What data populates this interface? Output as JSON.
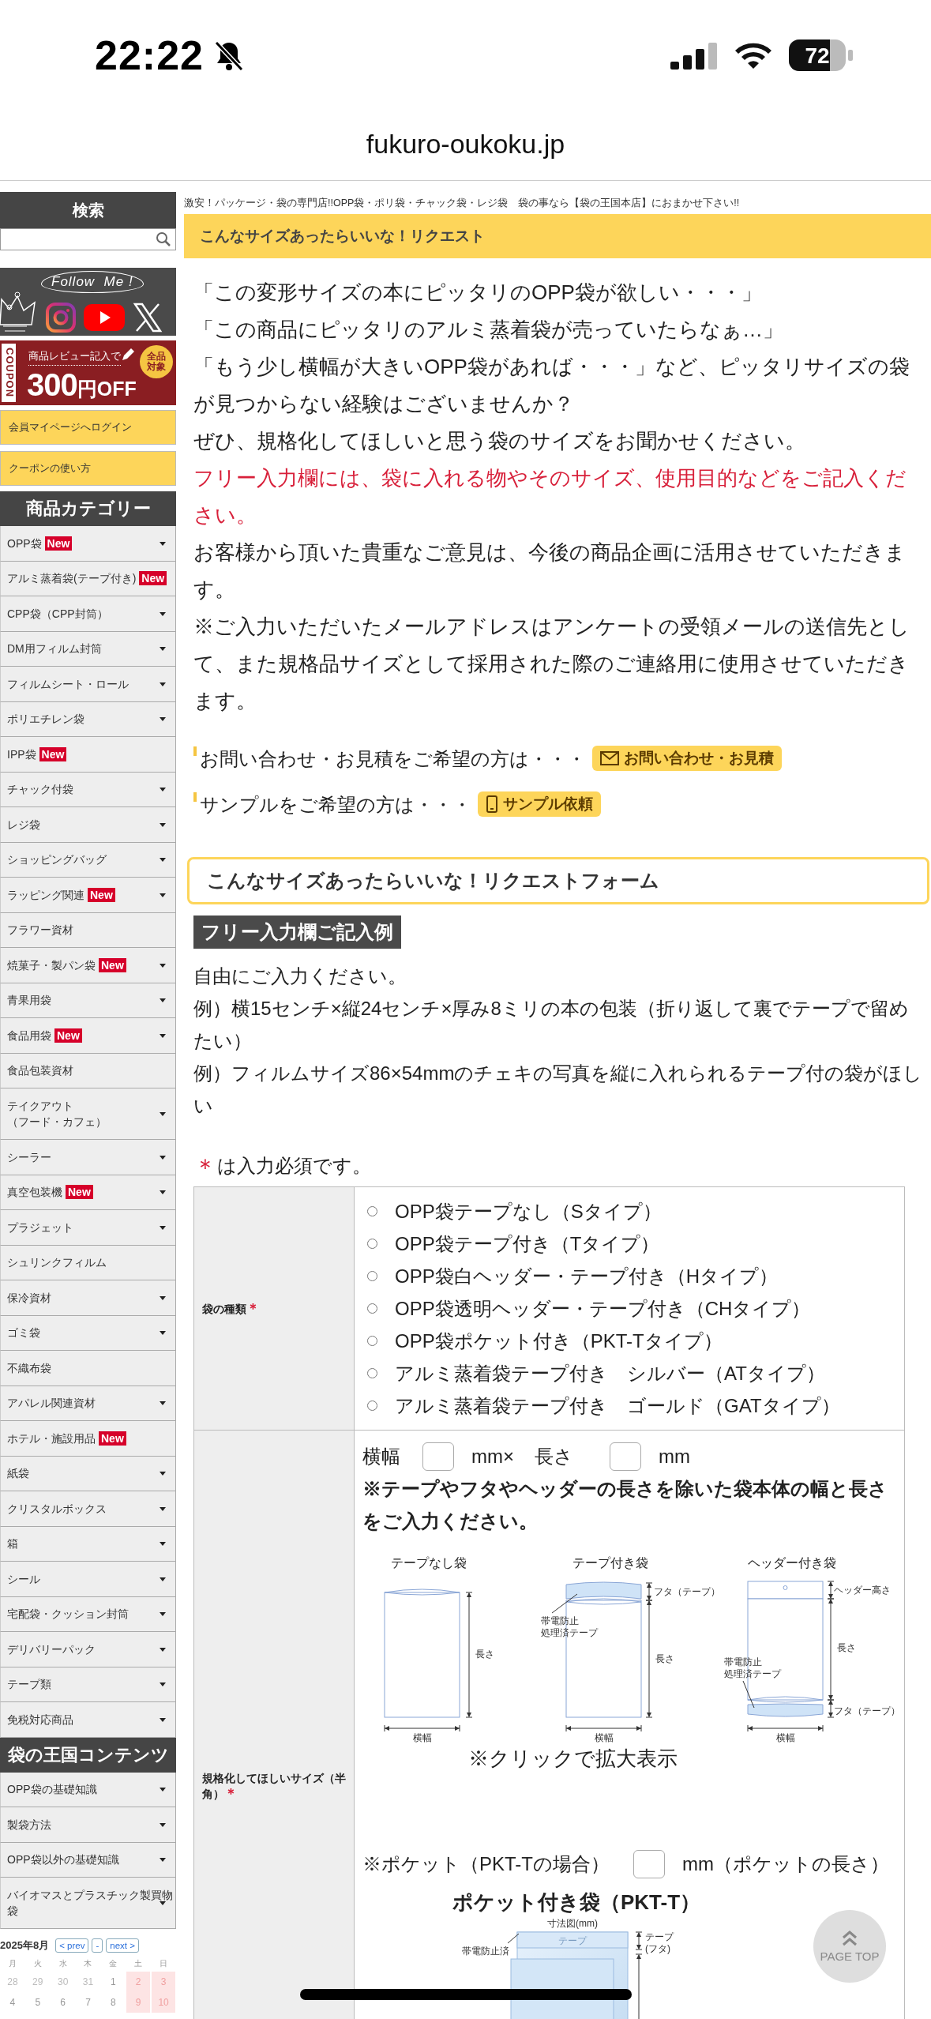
{
  "status_bar": {
    "time": "22:22",
    "battery": "72"
  },
  "browser": {
    "url": "fukuro-oukoku.jp"
  },
  "sidebar": {
    "search_title": "検索",
    "follow_banner": {
      "text": "Follow  Me !"
    },
    "coupon_banner": {
      "tab": "COUPON",
      "caption": "商品レビュー記入で",
      "amount": "300",
      "unit": "円OFF",
      "badge": "全品対象"
    },
    "links": [
      "会員マイページへログイン",
      "クーポンの使い方"
    ],
    "categories_title": "商品カテゴリー",
    "categories": [
      {
        "label": "OPP袋",
        "badge": "New",
        "expandable": true
      },
      {
        "label": "アルミ蒸着袋(テープ付き)",
        "badge": "New",
        "expandable": false
      },
      {
        "label": "CPP袋（CPP封筒）",
        "expandable": true
      },
      {
        "label": "DM用フィルム封筒",
        "expandable": true
      },
      {
        "label": "フィルムシート・ロール",
        "expandable": true
      },
      {
        "label": "ポリエチレン袋",
        "expandable": true
      },
      {
        "label": "IPP袋",
        "badge": "New",
        "expandable": false
      },
      {
        "label": "チャック付袋",
        "expandable": true
      },
      {
        "label": "レジ袋",
        "expandable": true
      },
      {
        "label": "ショッピングバッグ",
        "expandable": true
      },
      {
        "label": "ラッピング関連",
        "badge": "New",
        "expandable": true
      },
      {
        "label": "フラワー資材",
        "expandable": false
      },
      {
        "label": "焼菓子・製パン袋",
        "badge": "New",
        "expandable": true
      },
      {
        "label": "青果用袋",
        "expandable": true
      },
      {
        "label": "食品用袋",
        "badge": "New",
        "expandable": true
      },
      {
        "label": "食品包装資材",
        "expandable": false
      },
      {
        "label": "テイクアウト",
        "sublabel": "（フード・カフェ）",
        "expandable": true
      },
      {
        "label": "シーラー",
        "expandable": true
      },
      {
        "label": "真空包装機",
        "badge": "New",
        "expandable": true
      },
      {
        "label": "プラジェット",
        "expandable": true
      },
      {
        "label": "シュリンクフィルム",
        "expandable": false
      },
      {
        "label": "保冷資材",
        "expandable": true
      },
      {
        "label": "ゴミ袋",
        "expandable": true
      },
      {
        "label": "不織布袋",
        "expandable": false
      },
      {
        "label": "アパレル関連資材",
        "expandable": true
      },
      {
        "label": "ホテル・施設用品",
        "badge": "New",
        "expandable": false
      },
      {
        "label": "紙袋",
        "expandable": true
      },
      {
        "label": "クリスタルボックス",
        "expandable": true
      },
      {
        "label": "箱",
        "expandable": true
      },
      {
        "label": "シール",
        "expandable": true
      },
      {
        "label": "宅配袋・クッション封筒",
        "expandable": true
      },
      {
        "label": "デリバリーパック",
        "expandable": true
      },
      {
        "label": "テープ類",
        "expandable": true
      },
      {
        "label": "免税対応商品",
        "expandable": true
      }
    ],
    "contents_title": "袋の王国コンテンツ",
    "contents": [
      {
        "label": "OPP袋の基礎知識",
        "expandable": true
      },
      {
        "label": "製袋方法",
        "expandable": true
      },
      {
        "label": "OPP袋以外の基礎知識",
        "expandable": true
      },
      {
        "label": "バイオマスとプラスチック製買物袋",
        "expandable": true
      }
    ],
    "calendar": {
      "title": "2025年8月",
      "buttons": [
        "< prev",
        "-",
        "next >"
      ],
      "weekdays": [
        "月",
        "火",
        "水",
        "木",
        "金",
        "土",
        "日"
      ],
      "weeks": [
        [
          {
            "day": "28",
            "kind": "other"
          },
          {
            "day": "29",
            "kind": "other"
          },
          {
            "day": "30",
            "kind": "other"
          },
          {
            "day": "31",
            "kind": "other"
          },
          {
            "day": "1",
            "kind": "normal"
          },
          {
            "day": "2",
            "kind": "holiday"
          },
          {
            "day": "3",
            "kind": "holiday"
          }
        ],
        [
          {
            "day": "4",
            "kind": "normal"
          },
          {
            "day": "5",
            "kind": "normal"
          },
          {
            "day": "6",
            "kind": "normal"
          },
          {
            "day": "7",
            "kind": "normal"
          },
          {
            "day": "8",
            "kind": "normal"
          },
          {
            "day": "9",
            "kind": "holiday"
          },
          {
            "day": "10",
            "kind": "holiday"
          }
        ]
      ]
    }
  },
  "main": {
    "tagline": "激安！パッケージ・袋の専門店!!OPP袋・ポリ袋・チャック袋・レジ袋　袋の事なら【袋の王国本店】におまかせ下さい!!",
    "title": "こんなサイズあったらいいな！リクエスト",
    "quotes": [
      "「この変形サイズの本にピッタリのOPP袋が欲しい・・・」",
      "「この商品にピッタリのアルミ蒸着袋が売っていたらなぁ…」",
      "「もう少し横幅が大きいOPP袋があれば・・・」など、ピッタリサイズの袋が見つからない経験はございませんか？"
    ],
    "paragraphs": [
      {
        "kind": "normal",
        "text": "ぜひ、規格化してほしいと思う袋のサイズをお聞かせください。"
      },
      {
        "kind": "notice",
        "text": "フリー入力欄には、袋に入れる物やそのサイズ、使用目的などをご記入ください。"
      },
      {
        "kind": "normal",
        "text": "お客様から頂いた貴重なご意見は、今後の商品企画に活用させていただきます。"
      },
      {
        "kind": "normal",
        "text": "※ご入力いただいたメールアドレスはアンケートの受領メールの送信先として、また規格品サイズとして採用された際のご連絡用に使用させていただきます。"
      }
    ],
    "contacts": [
      {
        "text": "お問い合わせ・お見積をご希望の方は・・・",
        "button": "お問い合わせ・お見積",
        "kind": "mail"
      },
      {
        "text": "サンプルをご希望の方は・・・",
        "button": "サンプル依頼",
        "kind": "sample"
      }
    ],
    "form_title": "こんなサイズあったらいいな！リクエストフォーム",
    "example_title": "フリー入力欄ご記入例",
    "example_lines": [
      "自由にご入力ください。",
      "例）横15センチ×縦24センチ×厚み8ミリの本の包装（折り返して裏でテープで留めたい）",
      "例）フィルムサイズ86×54mmのチェキの写真を縦に入れられるテープ付の袋がほしい"
    ],
    "required_note": {
      "mark": "＊",
      "text": "は入力必須です。"
    },
    "form": {
      "bag_type": {
        "label": "袋の種類",
        "mark": "＊",
        "options": [
          {
            "label": "OPP袋テープなし（Sタイプ）",
            "selected": false
          },
          {
            "label": "OPP袋テープ付き（Tタイプ）",
            "selected": false
          },
          {
            "label": "OPP袋白ヘッダー・テープ付き（Hタイプ）",
            "selected": false
          },
          {
            "label": "OPP袋透明ヘッダー・テープ付き（CHタイプ）",
            "selected": false
          },
          {
            "label": "OPP袋ポケット付き（PKT-Tタイプ）",
            "selected": false
          },
          {
            "label": "アルミ蒸着袋テープ付き　シルバー（ATタイプ）",
            "selected": false
          },
          {
            "label": "アルミ蒸着袋テープ付き　ゴールド（GATタイプ）",
            "selected": false
          }
        ]
      },
      "size": {
        "label": "規格化してほしいサイズ（半角）",
        "mark": "＊",
        "width_label": "横幅",
        "width_unit": "mm×",
        "length_label": "長さ",
        "length_unit": "mm",
        "note": "※テープやフタやヘッダーの長さを除いた袋本体の幅と長さをご入力ください。",
        "diagrams": [
          {
            "kind": "plain",
            "title": "テープなし袋",
            "labels": [
              "長さ",
              "横幅"
            ]
          },
          {
            "kind": "tape",
            "title": "テープ付き袋",
            "labels": [
              "フタ（テープ）",
              "帯電防止",
              "処理済テープ",
              "長さ",
              "横幅"
            ]
          },
          {
            "kind": "header",
            "title": "ヘッダー付き袋",
            "labels": [
              "ヘッダー高さ",
              "長さ",
              "帯電防止",
              "処理済テープ",
              "フタ（テープ）",
              "横幅"
            ]
          }
        ],
        "zoom_note": "※クリックで拡大表示",
        "pocket_label": "※ポケット（PKT-Tの場合）",
        "pocket_unit": "mm（ポケットの長さ）",
        "pocket_title": "ポケット付き袋（PKT-T）",
        "pocket_labels": [
          "寸法図(mm)",
          "テープ",
          "帯電防止済",
          "テープ",
          "(フタ)"
        ]
      }
    }
  },
  "page_top": "PAGE TOP"
}
